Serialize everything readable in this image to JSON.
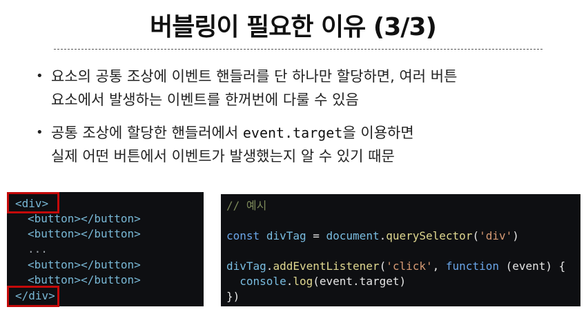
{
  "title": "버블링이 필요한 이유 (3/3)",
  "bullets": [
    {
      "line1": "요소의 공통 조상에 이벤트 핸들러를 단 하나만 할당하면, 여러 버튼",
      "line2": "요소에서 발생하는 이벤트를 한꺼번에 다룰 수 있음"
    },
    {
      "line1_before": "공통 조상에 할당한 핸들러에서 ",
      "line1_code": "event.target",
      "line1_after": "을 이용하면",
      "line2": "실제 어떤 버튼에서 이벤트가 발생했는지 알 수 있기 때문"
    }
  ],
  "bullet_marker": "•",
  "html_code": {
    "open_div": "<div>",
    "button_line": "<button></button>",
    "ellipsis": "...",
    "close_div": "</div>"
  },
  "js_code": {
    "comment": "// 예시",
    "line1": {
      "kw": "const",
      "var": "divTag",
      "eq": " = ",
      "obj": "document",
      "dot": ".",
      "method": "querySelector",
      "open": "(",
      "arg": "'div'",
      "close": ")"
    },
    "line2": {
      "obj": "divTag",
      "dot": ".",
      "method": "addEventListener",
      "open": "(",
      "arg": "'click'",
      "comma": ", ",
      "kw": "function",
      "params": " (event) {"
    },
    "line3": {
      "indent": "  ",
      "obj": "console",
      "dot": ".",
      "method": "log",
      "args": "(event.target)"
    },
    "line4": "})"
  },
  "colors": {
    "highlight_border": "#c40a0a",
    "code_background": "#0e0f12"
  }
}
